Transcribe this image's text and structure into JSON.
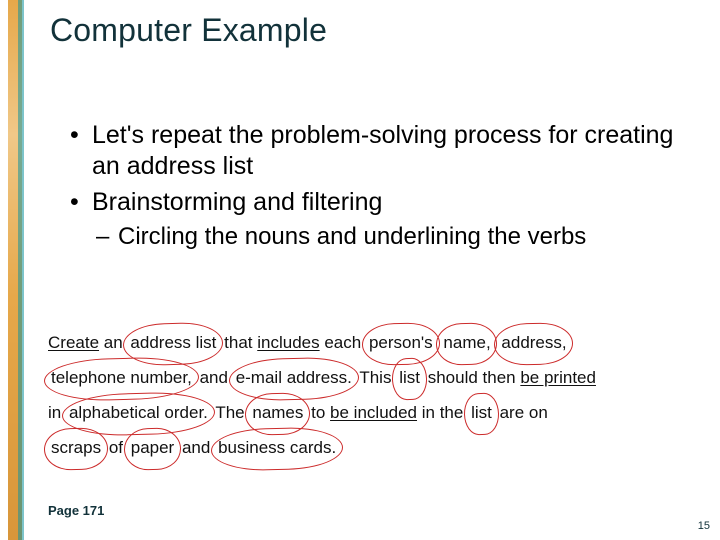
{
  "title": "Computer Example",
  "bullets": {
    "item1": "Let's repeat the problem-solving process for creating an address list",
    "item2": "Brainstorming and filtering",
    "sub1": "Circling the nouns and underlining the verbs"
  },
  "problem": {
    "w_create": "Create",
    "w_an": "an",
    "n_address_list": "address list",
    "w_that": "that",
    "w_includes": "includes",
    "w_each": "each",
    "n_persons": "person's",
    "n_name": "name,",
    "n_address": "address,",
    "n_telephone_number": "telephone number,",
    "w_and1": "and",
    "n_email_address": "e-mail address.",
    "w_this": "This",
    "n_list1": "list",
    "w_should_then": "should then",
    "w_be_printed": "be printed",
    "w_in": "in",
    "n_alphabetical_order": "alphabetical order.",
    "w_the": "The",
    "n_names": "names",
    "w_to": "to",
    "w_be_included": "be included",
    "w_in_the": "in the",
    "n_list2": "list",
    "w_are_on": "are on",
    "n_scraps": "scraps",
    "w_of": "of",
    "n_paper": "paper",
    "w_and2": "and",
    "n_business_cards": "business cards."
  },
  "page_ref": "Page 171",
  "slide_num": "15"
}
